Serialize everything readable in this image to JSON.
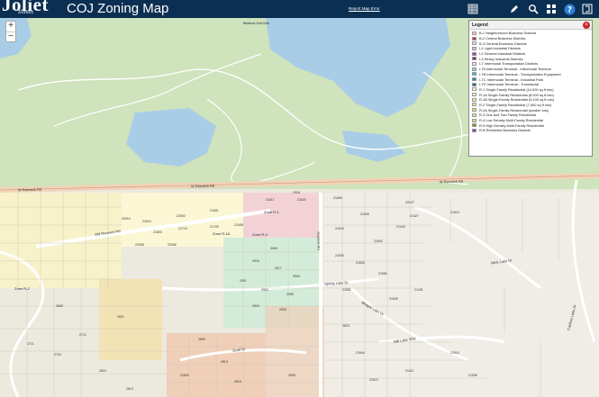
{
  "header": {
    "logo_text": "Joliet",
    "logo_sub": "Illinois",
    "title": "COJ Zoning Map",
    "report_link": "Report Map Error"
  },
  "toolbar": {
    "basemap_icon": "basemap-icon",
    "draw_icon": "pencil-icon",
    "search_icon": "search-icon",
    "layers_icon": "grid-icon",
    "help_icon": "help-icon",
    "share_icon": "share-icon"
  },
  "map": {
    "zoom_in": "+",
    "zoom_out": "−",
    "roads": {
      "renwick_w": "W Renwick Rd",
      "renwick_e": "W Renwick Rd",
      "old_renwick": "Old Renwick Rd",
      "gaylord": "Gaylord Rd",
      "spring_lake": "Spring Lake Dr",
      "scott": "Scott Dr",
      "mink": "Mink Lake Dr",
      "mill": "Mill Lake Way",
      "bhagat": "Bhagat Lake Dr",
      "caribou": "Caribou Lake Dr"
    },
    "zones": {
      "r1": "Zone R-1",
      "r1b": "Zone R-1A",
      "r3": "Zone R-3",
      "r2": "Zone R-2",
      "site": "Bellevue\nGolf Club"
    },
    "parcels": [
      "2916",
      "21620",
      "21617",
      "22014",
      "22010",
      "22002",
      "21601",
      "21725",
      "21719",
      "21650",
      "22107",
      "3005",
      "21515",
      "21628",
      "21530",
      "21542",
      "21443",
      "21427",
      "3016",
      "3017",
      "3004",
      "21603",
      "21608",
      "21540",
      "21610",
      "2901",
      "2910",
      "2905",
      "21550",
      "2915",
      "2830",
      "21531",
      "2605",
      "2621",
      "22008",
      "22006",
      "2712",
      "21605",
      "2809",
      "21431",
      "2814",
      "2704",
      "2711",
      "21411",
      "21619",
      "21600",
      "2815",
      "2823",
      "21644",
      "21510",
      "2624",
      "2613",
      "21535",
      "2900"
    ]
  },
  "legend": {
    "title": "Legend",
    "items": [
      {
        "code": "B-1",
        "label": "B-1 Neighborhood Business Districts",
        "color": "#f3c8d3"
      },
      {
        "code": "B-2",
        "label": "B-2 Central Business Districts",
        "color": "#b33b3b"
      },
      {
        "code": "B-3",
        "label": "B-3 General Business Districts",
        "color": "#f5d5e8"
      },
      {
        "code": "I-1",
        "label": "I-1 Light Industrial Districts",
        "color": "#d7b9e6"
      },
      {
        "code": "I-2",
        "label": "I-2 General Industrial Districts",
        "color": "#b030b8"
      },
      {
        "code": "I-3",
        "label": "I-3 Heavy Industrial Districts",
        "color": "#7a2a73"
      },
      {
        "code": "I-T",
        "label": "I-T Intermodal Transportation Districts",
        "color": "#e7e7e7"
      },
      {
        "code": "I-TA",
        "label": "I-TA Intermodal Terminal - Intermodal Terminal",
        "color": "#7fd6e0"
      },
      {
        "code": "I-TB",
        "label": "I-TB Intermodal Terminal - Transportation Equipment",
        "color": "#45b6c4"
      },
      {
        "code": "I-TC",
        "label": "I-TC Intermodal Terminal - Industrial Park",
        "color": "#2a8ea2"
      },
      {
        "code": "I-TD",
        "label": "I-TD Intermodal Terminal - Transitional",
        "color": "#1d6f7f"
      },
      {
        "code": "R-1",
        "label": "R-1 Single-Family Residential (10,000 sq ft min)",
        "color": "#fbf7d5"
      },
      {
        "code": "R-1A",
        "label": "R-1A Single-Family Residential (8,000 sq ft min)",
        "color": "#f6f0b5"
      },
      {
        "code": "R-1B",
        "label": "R-1B Single-Family Residential (9,100 sq ft min)",
        "color": "#eef09a"
      },
      {
        "code": "R-2",
        "label": "R-2 Single-Family Residential (7,500 sq ft min)",
        "color": "#efe28c"
      },
      {
        "code": "R-2A",
        "label": "R-2A Single-Family Residential (smaller lots)",
        "color": "#e9d977"
      },
      {
        "code": "R-3",
        "label": "R-3 One and Two Family Residential",
        "color": "#d4e8a0"
      },
      {
        "code": "R-4",
        "label": "R-4 Low Density Multi-Family Residential",
        "color": "#c6dc9a"
      },
      {
        "code": "R-5",
        "label": "R-5 High Density Multi-Family Residential",
        "color": "#8c8c2c"
      },
      {
        "code": "R-B",
        "label": "R-B Restricted Business Districts",
        "color": "#a03ab0"
      }
    ]
  }
}
